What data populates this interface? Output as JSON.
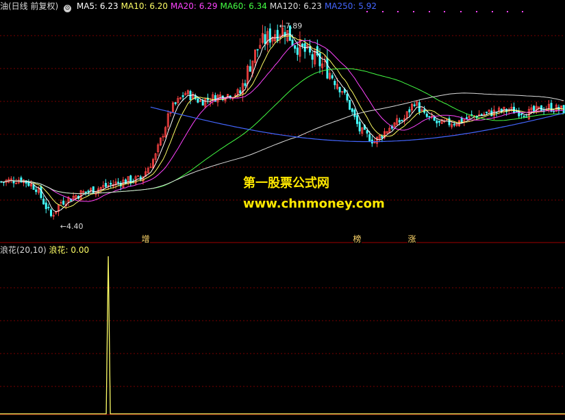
{
  "header": {
    "title": "油(日线 前复权)",
    "indicators": [
      {
        "label": "MA5: 6.23",
        "color": "#ffffff"
      },
      {
        "label": "MA10: 6.20",
        "color": "#ffff66"
      },
      {
        "label": "MA20: 6.29",
        "color": "#ff44ff"
      },
      {
        "label": "MA60: 6.34",
        "color": "#44ff44"
      },
      {
        "label": "MA120: 6.23",
        "color": "#dddddd"
      },
      {
        "label": "MA250: 5.92",
        "color": "#4466ff"
      }
    ]
  },
  "sub_header": {
    "name": "浪花(20,10)",
    "value_label": "浪花: 0.00",
    "value_color": "#ffff66"
  },
  "watermark": {
    "line1": "第一股票公式网",
    "line2": "www.chnmoney.com"
  },
  "tags": [
    {
      "text": "增",
      "x_index": 58
    },
    {
      "text": "榜",
      "x_index": 143
    },
    {
      "text": "涨",
      "x_index": 165
    }
  ],
  "colors": {
    "up": "#ff4444",
    "down": "#44ffff",
    "grid": "#7a0000",
    "divider": "#a00000",
    "ma5": "#ffffff",
    "ma10": "#ffff66",
    "ma20": "#ff44ff",
    "ma60": "#44ff44",
    "ma120": "#dddddd",
    "ma250": "#4466ff",
    "sub_line": "#ffff66"
  },
  "chart_data": [
    {
      "type": "candlestick",
      "annotations": [
        {
          "label": "7.89",
          "value": 7.89
        },
        {
          "label": "4.40",
          "value": 4.4
        }
      ],
      "ylim": [
        4.2,
        8.1
      ],
      "anchors": [
        [
          0,
          5.15
        ],
        [
          8,
          5.2
        ],
        [
          14,
          5.05
        ],
        [
          20,
          4.55
        ],
        [
          24,
          4.8
        ],
        [
          32,
          4.95
        ],
        [
          40,
          5.05
        ],
        [
          48,
          5.15
        ],
        [
          56,
          5.2
        ],
        [
          62,
          5.6
        ],
        [
          68,
          6.4
        ],
        [
          74,
          6.7
        ],
        [
          80,
          6.55
        ],
        [
          88,
          6.65
        ],
        [
          96,
          6.7
        ],
        [
          100,
          7.2
        ],
        [
          104,
          7.55
        ],
        [
          110,
          7.75
        ],
        [
          114,
          7.8
        ],
        [
          118,
          7.55
        ],
        [
          124,
          7.35
        ],
        [
          130,
          7.15
        ],
        [
          136,
          6.85
        ],
        [
          140,
          6.45
        ],
        [
          144,
          6.05
        ],
        [
          150,
          5.85
        ],
        [
          156,
          6.1
        ],
        [
          162,
          6.25
        ],
        [
          166,
          6.55
        ],
        [
          170,
          6.3
        ],
        [
          176,
          6.15
        ],
        [
          184,
          6.2
        ],
        [
          190,
          6.3
        ],
        [
          196,
          6.35
        ],
        [
          204,
          6.4
        ],
        [
          212,
          6.35
        ],
        [
          220,
          6.45
        ],
        [
          226,
          6.4
        ]
      ],
      "bars": 227
    },
    {
      "type": "line",
      "name": "浪花",
      "ylim": [
        0,
        100
      ],
      "spikes": [
        {
          "index": 43,
          "value": 100
        }
      ],
      "base": 0
    }
  ]
}
